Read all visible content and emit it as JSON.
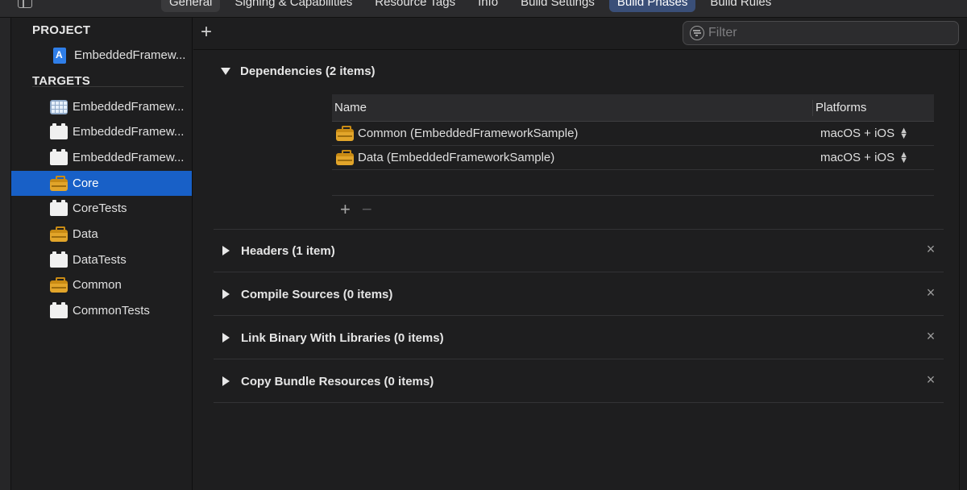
{
  "tabs": [
    {
      "label": "General",
      "selected": false
    },
    {
      "label": "Signing & Capabilities",
      "selected": false
    },
    {
      "label": "Resource Tags",
      "selected": false
    },
    {
      "label": "Info",
      "selected": false
    },
    {
      "label": "Build Settings",
      "selected": false
    },
    {
      "label": "Build Phases",
      "selected": true
    },
    {
      "label": "Build Rules",
      "selected": false
    }
  ],
  "sidebar": {
    "project_header": "PROJECT",
    "project_item": {
      "label": "EmbeddedFramew...",
      "icon": "project-icon"
    },
    "targets_header": "TARGETS",
    "targets": [
      {
        "label": "EmbeddedFramew...",
        "icon": "app-icon",
        "selected": false
      },
      {
        "label": "EmbeddedFramew...",
        "icon": "test-bundle-icon",
        "selected": false
      },
      {
        "label": "EmbeddedFramew...",
        "icon": "test-bundle-icon",
        "selected": false
      },
      {
        "label": "Core",
        "icon": "framework-toolbox-icon",
        "selected": true
      },
      {
        "label": "CoreTests",
        "icon": "test-bundle-icon",
        "selected": false
      },
      {
        "label": "Data",
        "icon": "framework-toolbox-icon",
        "selected": false
      },
      {
        "label": "DataTests",
        "icon": "test-bundle-icon",
        "selected": false
      },
      {
        "label": "Common",
        "icon": "framework-toolbox-icon",
        "selected": false
      },
      {
        "label": "CommonTests",
        "icon": "test-bundle-icon",
        "selected": false
      }
    ]
  },
  "toolbar": {
    "add_label": "+",
    "filter_placeholder": "Filter"
  },
  "phases": {
    "dependencies": {
      "title": "Dependencies (2 items)",
      "expanded": true,
      "columns": {
        "name": "Name",
        "platforms": "Platforms"
      },
      "rows": [
        {
          "name": "Common (EmbeddedFrameworkSample)",
          "platforms": "macOS + iOS"
        },
        {
          "name": "Data (EmbeddedFrameworkSample)",
          "platforms": "macOS + iOS"
        }
      ],
      "add_label": "+",
      "remove_label": "−"
    },
    "headers": {
      "title": "Headers (1 item)",
      "expanded": false
    },
    "compile_sources": {
      "title": "Compile Sources (0 items)",
      "expanded": false
    },
    "link_binary": {
      "title": "Link Binary With Libraries (0 items)",
      "expanded": false
    },
    "copy_bundle": {
      "title": "Copy Bundle Resources (0 items)",
      "expanded": false
    }
  },
  "close_label": "×",
  "colors": {
    "accent": "#1860c7",
    "selected_tab": "#3a4f78",
    "background": "#1e1e1f",
    "framework_icon": "#e2a52a"
  }
}
